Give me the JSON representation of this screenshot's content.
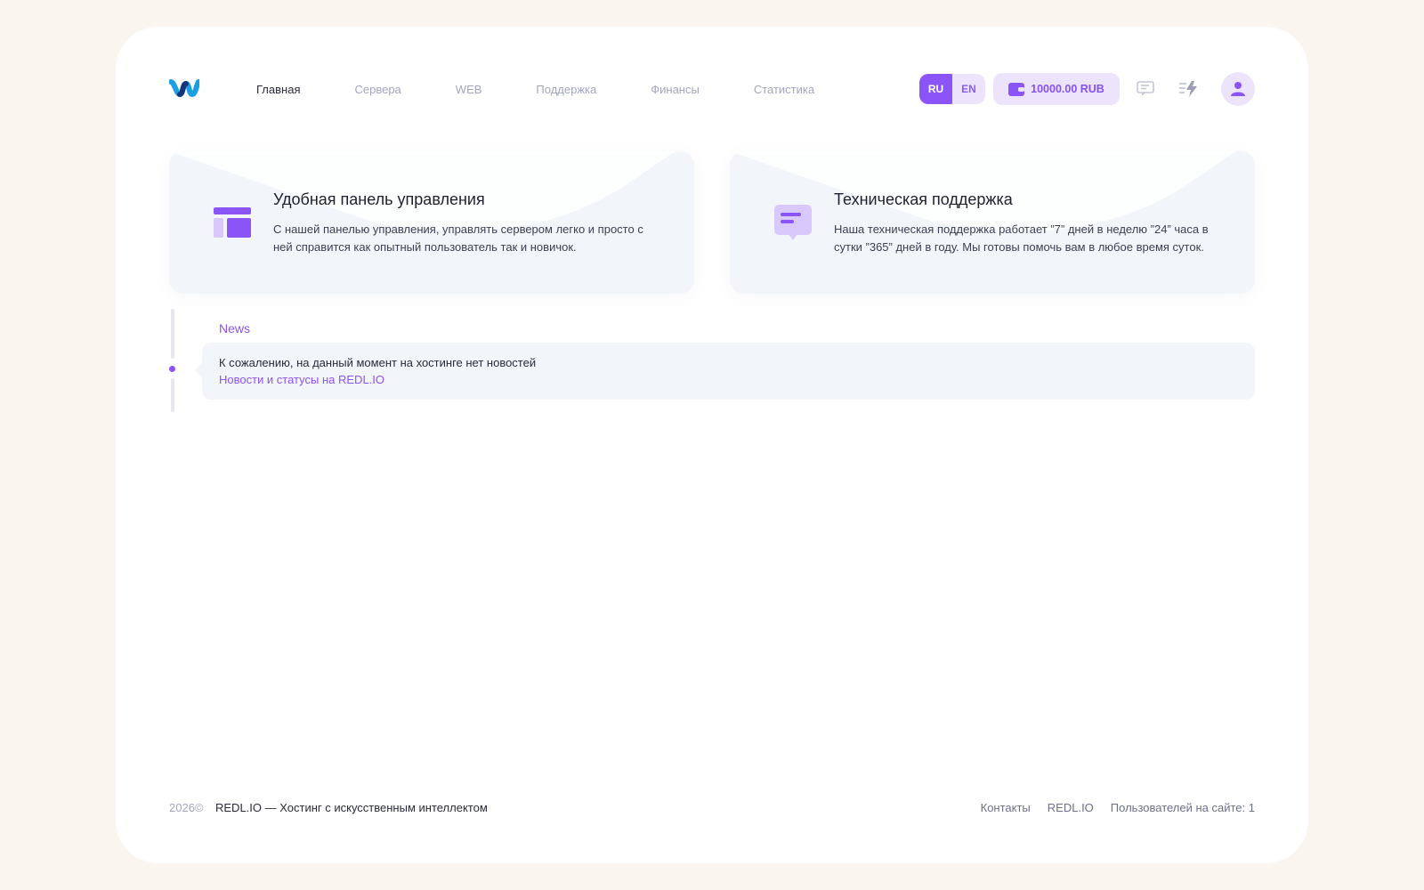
{
  "header": {
    "nav": [
      {
        "label": "Главная",
        "active": true
      },
      {
        "label": "Сервера",
        "active": false
      },
      {
        "label": "WEB",
        "active": false
      },
      {
        "label": "Поддержка",
        "active": false
      },
      {
        "label": "Финансы",
        "active": false
      },
      {
        "label": "Статистика",
        "active": false
      }
    ],
    "languages": [
      {
        "label": "RU",
        "selected": true
      },
      {
        "label": "EN",
        "selected": false
      }
    ],
    "balance": "10000.00 RUB",
    "icons": [
      "logo-icon",
      "wallet-icon",
      "chat-icon",
      "lightning-icon",
      "user-icon"
    ]
  },
  "features": [
    {
      "title": "Удобная панель управления",
      "description": "С нашей панелью управления, управлять сервером легко и просто с ней справится как опытный пользователь так и новичок.",
      "icon": "dashboard-icon"
    },
    {
      "title": "Техническая поддержка",
      "description": "Наша техническая поддержка работает ”7” дней в неделю ”24” часа в сутки ”365” дней в году. Мы готовы помочь вам в любое время суток.",
      "icon": "message-icon"
    }
  ],
  "news": {
    "label": "News",
    "empty_text": "К сожалению, на данный момент на хостинге нет новостей",
    "link_text": "Новости и статусы на REDL.IO"
  },
  "footer": {
    "year": "2026©",
    "brand": "REDL.IO — Хостинг с искусственным интеллектом",
    "links": [
      "Контакты",
      "REDL.IO",
      "Пользователей на сайте: 1"
    ]
  },
  "colors": {
    "accent": "#8b54f6",
    "accent_soft": "#ece4fd",
    "card_bg": "#f2f5f9",
    "page_bg": "#faf6ef",
    "muted_text": "#a2a5bd"
  }
}
